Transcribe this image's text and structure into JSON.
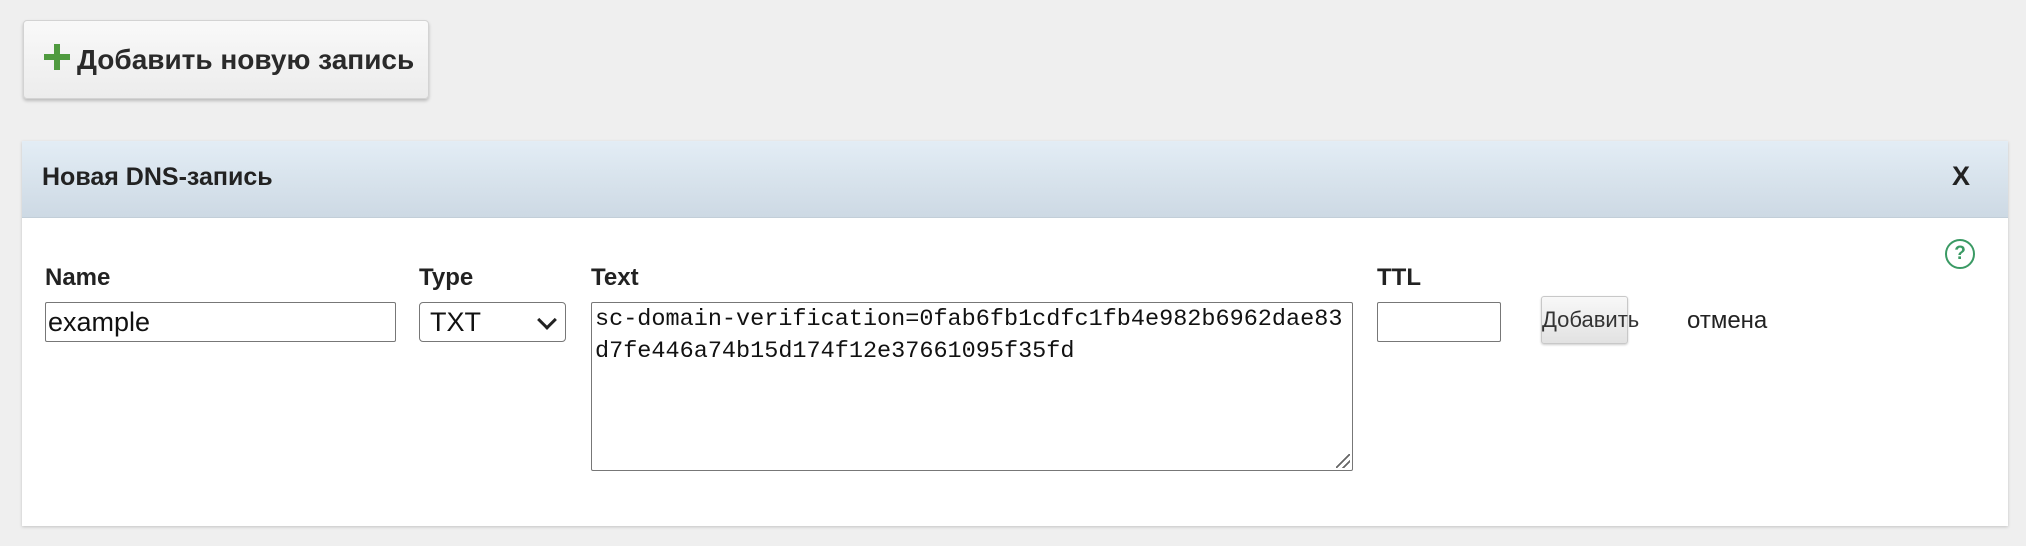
{
  "toolbar": {
    "add_new_label": "Добавить новую запись",
    "add_icon": "plus-icon"
  },
  "panel": {
    "title": "Новая DNS-запись",
    "close_label": "X",
    "help_symbol": "?"
  },
  "form": {
    "name_label": "Name",
    "name_value": "example",
    "type_label": "Type",
    "type_value": "TXT",
    "text_label": "Text",
    "text_value": "sc-domain-verification=0fab6fb1cdfc1fb4e982b6962dae83d7fe446a74b15d174f12e37661095f35fd",
    "ttl_label": "TTL",
    "ttl_value": "",
    "submit_label": "Добавить",
    "cancel_label": "отмена"
  },
  "colors": {
    "plus_green": "#4f9a3f",
    "help_green": "#3a9a64",
    "header_bg": "#d6e2ec",
    "page_bg": "#efefef"
  }
}
